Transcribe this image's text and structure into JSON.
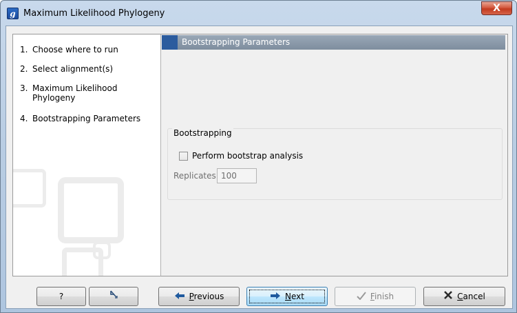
{
  "window": {
    "title": "Maximum Likelihood Phylogeny",
    "app_icon_letter": "g",
    "close_symbol": "X"
  },
  "steps": [
    {
      "number": "1.",
      "label": "Choose where to run"
    },
    {
      "number": "2.",
      "label": "Select alignment(s)"
    },
    {
      "number": "3.",
      "label": "Maximum Likelihood",
      "label2": "Phylogeny"
    },
    {
      "number": "4.",
      "label": "Bootstrapping Parameters"
    }
  ],
  "panel": {
    "header": "Bootstrapping Parameters",
    "group_title": "Bootstrapping",
    "checkbox_label": "Perform bootstrap analysis",
    "checkbox_checked": false,
    "replicates_label": "Replicates",
    "replicates_value": "100"
  },
  "buttons": {
    "help": "?",
    "previous_first": "P",
    "previous_rest": "revious",
    "next_first": "N",
    "next_rest": "ext",
    "finish_first": "F",
    "finish_rest": "inish",
    "cancel_first": "C",
    "cancel_rest": "ancel"
  },
  "colors": {
    "header_bar": "#7e8d9e",
    "header_accent": "#2c5c9e",
    "close_button": "#c23b1f",
    "focus_button": "#bee6fd"
  }
}
